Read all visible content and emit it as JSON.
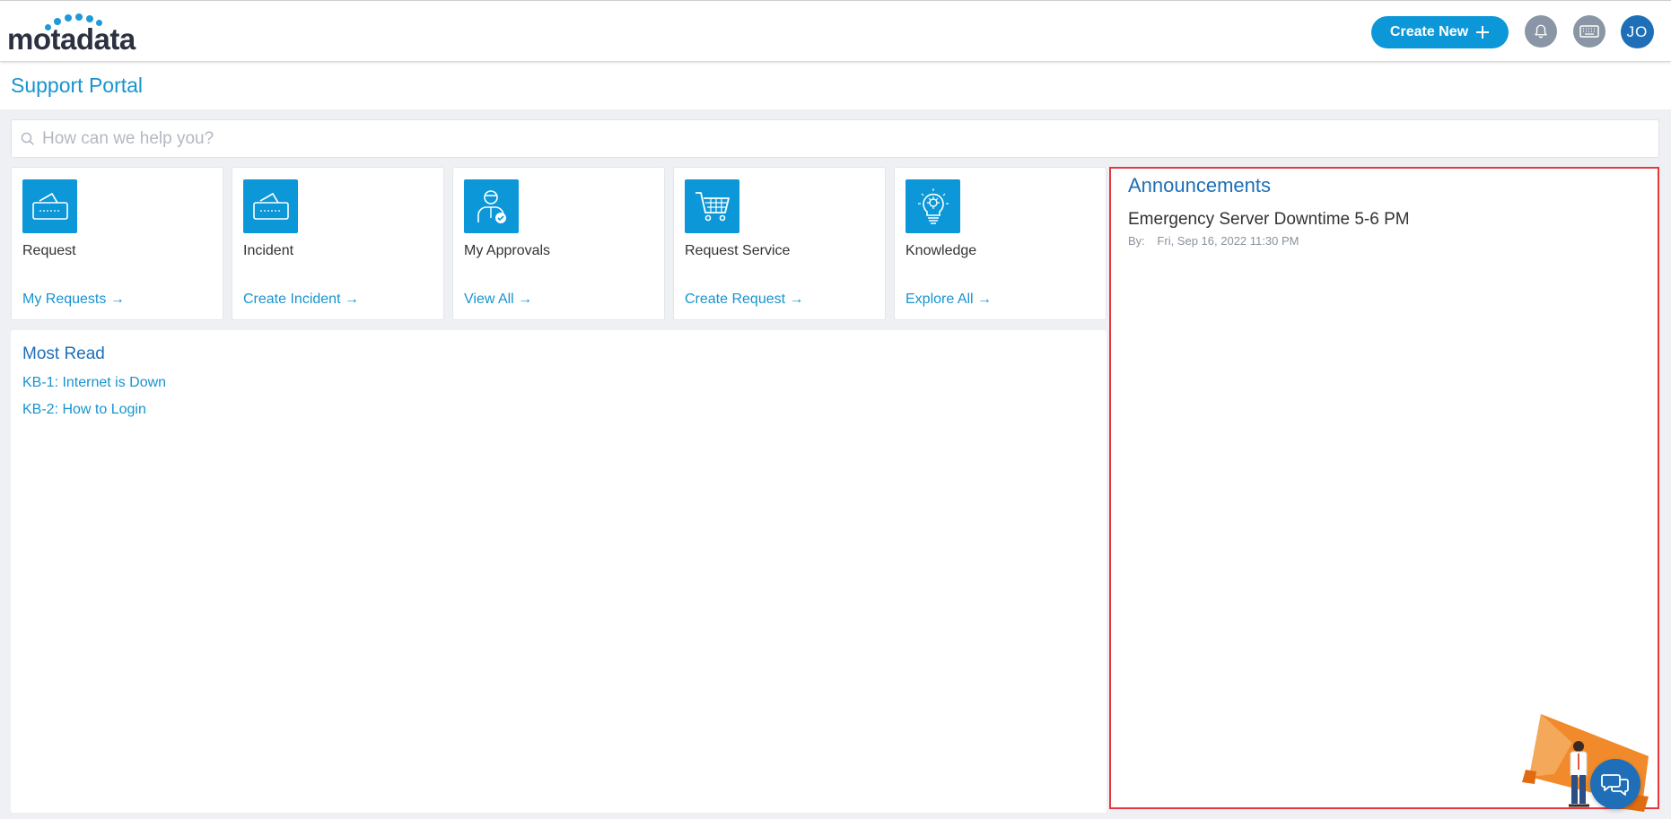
{
  "brand": {
    "logo_text": "motadata",
    "accent": "#0b97d8",
    "link_color": "#1794cf",
    "highlight_border": "#e6383c"
  },
  "header": {
    "create_new_label": "Create New",
    "avatar_initials": "JO",
    "icons": [
      "plus-icon",
      "bell-icon",
      "keyboard-icon"
    ]
  },
  "page_title": "Support Portal",
  "search": {
    "placeholder": "How can we help you?",
    "value": ""
  },
  "cards": [
    {
      "title": "Request",
      "link": "My Requests",
      "icon": "ticket-icon"
    },
    {
      "title": "Incident",
      "link": "Create Incident",
      "icon": "ticket-icon"
    },
    {
      "title": "My Approvals",
      "link": "View All",
      "icon": "approver-icon"
    },
    {
      "title": "Request Service",
      "link": "Create Request",
      "icon": "cart-icon"
    },
    {
      "title": "Knowledge",
      "link": "Explore All",
      "icon": "lightbulb-icon"
    }
  ],
  "most_read": {
    "title": "Most Read",
    "items": [
      "KB-1: Internet is Down",
      "KB-2: How to Login"
    ]
  },
  "announcements": {
    "title": "Announcements",
    "items": [
      {
        "title": "Emergency Server Downtime 5-6 PM",
        "by_label": "By:",
        "date": "Fri, Sep 16, 2022 11:30 PM"
      }
    ]
  }
}
